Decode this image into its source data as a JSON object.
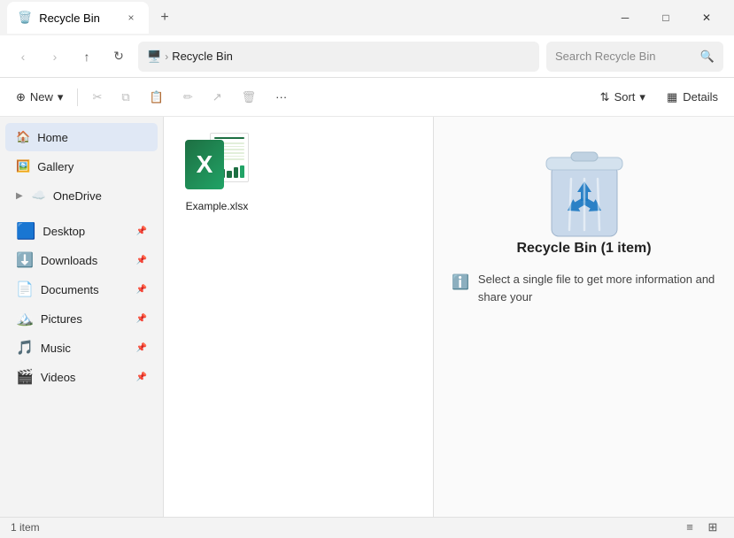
{
  "titlebar": {
    "tab_title": "Recycle Bin",
    "tab_icon": "🗑️",
    "close_tab": "×",
    "add_tab": "+",
    "win_minimize": "─",
    "win_maximize": "□",
    "win_close": "✕"
  },
  "addressbar": {
    "nav_back": "‹",
    "nav_forward": "›",
    "nav_up": "↑",
    "nav_refresh": "↻",
    "path_desktop": "🖥",
    "path_sep": "›",
    "path_location": "Recycle Bin",
    "search_placeholder": "Search Recycle Bin",
    "search_icon": "🔍"
  },
  "toolbar": {
    "new_label": "New",
    "new_caret": "▾",
    "cut_icon": "✂",
    "copy_icon": "⧉",
    "paste_icon": "📋",
    "rename_icon": "✏",
    "share_icon": "↗",
    "delete_icon": "🗑",
    "more_icon": "···",
    "sort_label": "Sort",
    "sort_icon": "⇅",
    "sort_caret": "▾",
    "details_icon": "▦",
    "details_label": "Details"
  },
  "sidebar": {
    "items": [
      {
        "id": "home",
        "label": "Home",
        "icon": "🏠",
        "active": true,
        "pinned": false,
        "expandable": false
      },
      {
        "id": "gallery",
        "label": "Gallery",
        "icon": "🖼",
        "active": false,
        "pinned": false,
        "expandable": false
      },
      {
        "id": "onedrive",
        "label": "OneDrive",
        "icon": "☁",
        "active": false,
        "pinned": false,
        "expandable": true
      }
    ],
    "pinned": [
      {
        "id": "desktop",
        "label": "Desktop",
        "icon": "🟦",
        "pinned": true
      },
      {
        "id": "downloads",
        "label": "Downloads",
        "icon": "⬇",
        "pinned": true
      },
      {
        "id": "documents",
        "label": "Documents",
        "icon": "📄",
        "pinned": true
      },
      {
        "id": "pictures",
        "label": "Pictures",
        "icon": "🏔",
        "pinned": true
      },
      {
        "id": "music",
        "label": "Music",
        "icon": "🎵",
        "pinned": true
      },
      {
        "id": "videos",
        "label": "Videos",
        "icon": "🎬",
        "pinned": true
      }
    ]
  },
  "filearea": {
    "file": {
      "name": "Example.xlsx",
      "type": "excel"
    }
  },
  "preview": {
    "title": "Recycle Bin (1 item)",
    "info_text": "Select a single file to get more information and share your"
  },
  "statusbar": {
    "count": "1 item"
  }
}
